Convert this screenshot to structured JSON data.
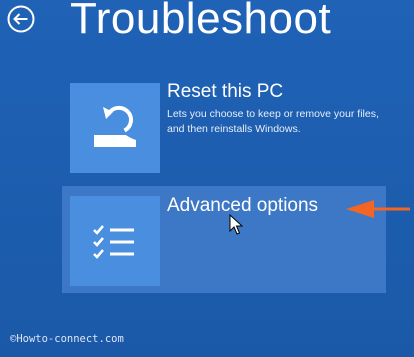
{
  "header": {
    "title": "Troubleshoot",
    "back_icon": "back-arrow-icon"
  },
  "options": [
    {
      "title": "Reset this PC",
      "description": "Lets you choose to keep or remove your files, and then reinstalls Windows.",
      "icon": "reset-pc-icon"
    },
    {
      "title": "Advanced options",
      "description": "",
      "icon": "checklist-icon"
    }
  ],
  "annotation": {
    "icon": "orange-pointer-arrow-icon",
    "color": "#f26522"
  },
  "watermark": "©Howto-connect.com",
  "colors": {
    "background": "#1e5fb0",
    "tile": "#4a8ee0",
    "selected_row": "#3d78c6",
    "text": "#ffffff"
  }
}
